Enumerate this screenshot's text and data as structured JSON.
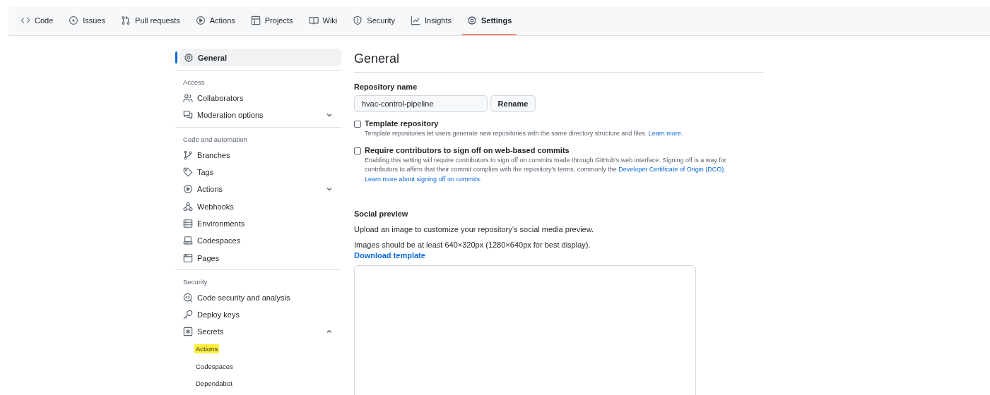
{
  "repo_nav": {
    "tabs": [
      {
        "label": "Code",
        "selected": false
      },
      {
        "label": "Issues",
        "selected": false
      },
      {
        "label": "Pull requests",
        "selected": false
      },
      {
        "label": "Actions",
        "selected": false
      },
      {
        "label": "Projects",
        "selected": false
      },
      {
        "label": "Wiki",
        "selected": false
      },
      {
        "label": "Security",
        "selected": false
      },
      {
        "label": "Insights",
        "selected": false
      },
      {
        "label": "Settings",
        "selected": true
      }
    ]
  },
  "sidebar": {
    "top_item": {
      "label": "General",
      "selected": true
    },
    "sections": [
      {
        "heading": "Access",
        "items": [
          {
            "label": "Collaborators"
          },
          {
            "label": "Moderation options",
            "expanded": false
          }
        ]
      },
      {
        "heading": "Code and automation",
        "items": [
          {
            "label": "Branches"
          },
          {
            "label": "Tags"
          },
          {
            "label": "Actions",
            "expanded": false
          },
          {
            "label": "Webhooks"
          },
          {
            "label": "Environments"
          },
          {
            "label": "Codespaces"
          },
          {
            "label": "Pages"
          }
        ]
      },
      {
        "heading": "Security",
        "items": [
          {
            "label": "Code security and analysis"
          },
          {
            "label": "Deploy keys"
          },
          {
            "label": "Secrets",
            "expanded": true,
            "children": [
              {
                "label": "Actions",
                "highlighted": true
              },
              {
                "label": "Codespaces",
                "highlighted": false
              },
              {
                "label": "Dependabot",
                "highlighted": false
              }
            ]
          }
        ]
      }
    ]
  },
  "main": {
    "title": "General",
    "repository_name": {
      "label": "Repository name",
      "value": "hvac-control-pipeline",
      "button": "Rename"
    },
    "options": [
      {
        "label": "Template repository",
        "checked": false,
        "description": [
          {
            "kind": "text",
            "text": "Template repositories let users generate new repositories with the same directory structure and files. "
          },
          {
            "kind": "link",
            "text": "Learn more"
          },
          {
            "kind": "text",
            "text": "."
          }
        ]
      },
      {
        "label": "Require contributors to sign off on web-based commits",
        "checked": false,
        "description": [
          {
            "kind": "text",
            "text": "Enabling this setting will require contributors to sign off on commits made through GitHub’s web interface. Signing off is a way for contributors to affirm that their commit complies with the repository’s terms, commonly the "
          },
          {
            "kind": "link",
            "text": "Developer Certificate of Origin (DCO)"
          },
          {
            "kind": "text",
            "text": ". "
          },
          {
            "kind": "link",
            "text": "Learn more about signing off on commits"
          },
          {
            "kind": "text",
            "text": "."
          }
        ]
      }
    ],
    "social_preview": {
      "heading": "Social preview",
      "intro": "Upload an image to customize your repository’s social media preview.",
      "requirement": "Images should be at least 640×320px (1280×640px for best display).",
      "link": "Download template"
    }
  }
}
